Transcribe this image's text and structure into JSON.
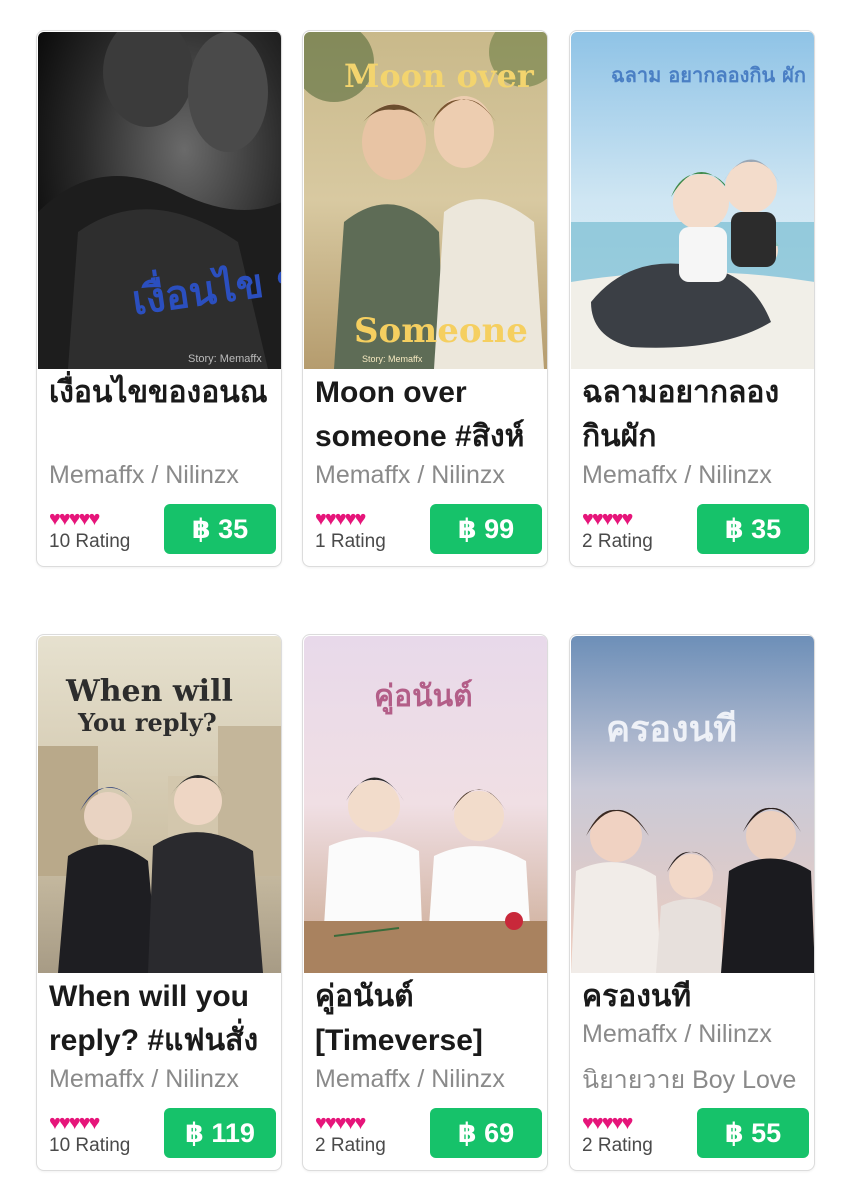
{
  "currency_symbol": "฿",
  "colors": {
    "accent": "#16c26a",
    "heart": "#e6157a"
  },
  "rows": [
    [
      {
        "title": "เงื่อนไขของอนณ",
        "author": "Memaffx / Nilinzx",
        "tag": "",
        "hearts": "♥♥♥♥♥",
        "rating_text": "10 Rating",
        "price": "฿ 35",
        "cover": {
          "title": "เงื่อนไข ของอนณ",
          "credit": "Story: Memaffx",
          "icon": "cover-dark-portrait"
        }
      },
      {
        "title": "Moon over someone #สิงห์",
        "author": "Memaffx / Nilinzx",
        "tag": "",
        "hearts": "♥♥♥♥♥",
        "rating_text": "1 Rating",
        "price": "฿ 99",
        "cover": {
          "title": "Moon over",
          "subtitle": "Someone",
          "credit": "Story: Memaffx",
          "icon": "cover-two-men-sunlight"
        }
      },
      {
        "title": "ฉลามอยากลองกินผัก",
        "author": "Memaffx / Nilinzx",
        "tag": "",
        "hearts": "♥♥♥♥♥",
        "rating_text": "2 Rating",
        "price": "฿ 35",
        "cover": {
          "title": "ฉลาม อยากลองกิน ผัก",
          "icon": "cover-chibi-beach"
        }
      }
    ],
    [
      {
        "title": "When will you reply? #แฟนสั่ง",
        "author": "Memaffx / Nilinzx",
        "tag": "",
        "hearts": "♥♥♥♥♥",
        "rating_text": "10 Rating",
        "price": "฿ 119",
        "cover": {
          "title": "When will",
          "subtitle": "You reply?",
          "icon": "cover-city-street"
        }
      },
      {
        "title": "คู่อนันต์ [Timeverse]",
        "author": "Memaffx / Nilinzx",
        "tag": "",
        "hearts": "♥♥♥♥♥",
        "rating_text": "2 Rating",
        "price": "฿ 69",
        "cover": {
          "title": "คู่อนันต์",
          "icon": "cover-classroom-desk"
        }
      },
      {
        "title": "ครองนที",
        "author": "Memaffx / Nilinzx",
        "tag": "นิยายวาย Boy Love",
        "hearts": "♥♥♥♥♥",
        "rating_text": "2 Rating",
        "price": "฿ 55",
        "cover": {
          "title": "ครองนที",
          "icon": "cover-sunset-group"
        }
      }
    ]
  ]
}
